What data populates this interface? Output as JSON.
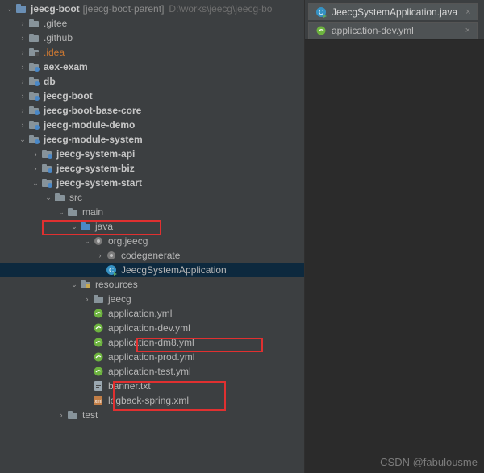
{
  "project": {
    "root_name": "jeecg-boot",
    "root_suffix": "[jeecg-boot-parent]",
    "root_path": "D:\\works\\jeecg\\jeecg-bo"
  },
  "tree": [
    {
      "d": 0,
      "arrow": "down",
      "icon": "proj",
      "label": "jeecg-boot",
      "extra": "root"
    },
    {
      "d": 1,
      "arrow": "right",
      "icon": "folder",
      "label": ".gitee"
    },
    {
      "d": 1,
      "arrow": "right",
      "icon": "folder",
      "label": ".github"
    },
    {
      "d": 1,
      "arrow": "right",
      "icon": "folderx",
      "label": ".idea",
      "style": "idea"
    },
    {
      "d": 1,
      "arrow": "right",
      "icon": "module",
      "label": "aex-exam",
      "bold": true
    },
    {
      "d": 1,
      "arrow": "right",
      "icon": "module",
      "label": "db",
      "bold": true
    },
    {
      "d": 1,
      "arrow": "right",
      "icon": "module",
      "label": "jeecg-boot",
      "bold": true
    },
    {
      "d": 1,
      "arrow": "right",
      "icon": "module",
      "label": "jeecg-boot-base-core",
      "bold": true
    },
    {
      "d": 1,
      "arrow": "right",
      "icon": "module",
      "label": "jeecg-module-demo",
      "bold": true
    },
    {
      "d": 1,
      "arrow": "down",
      "icon": "module",
      "label": "jeecg-module-system",
      "bold": true
    },
    {
      "d": 2,
      "arrow": "right",
      "icon": "module",
      "label": "jeecg-system-api",
      "bold": true
    },
    {
      "d": 2,
      "arrow": "right",
      "icon": "module",
      "label": "jeecg-system-biz",
      "bold": true
    },
    {
      "d": 2,
      "arrow": "down",
      "icon": "module",
      "label": "jeecg-system-start",
      "bold": true
    },
    {
      "d": 3,
      "arrow": "down",
      "icon": "folder",
      "label": "src"
    },
    {
      "d": 4,
      "arrow": "down",
      "icon": "folder",
      "label": "main"
    },
    {
      "d": 5,
      "arrow": "down",
      "icon": "srcroot",
      "label": "java"
    },
    {
      "d": 6,
      "arrow": "down",
      "icon": "package",
      "label": "org.jeecg"
    },
    {
      "d": 7,
      "arrow": "right",
      "icon": "package",
      "label": "codegenerate"
    },
    {
      "d": 7,
      "arrow": "none",
      "icon": "class-run",
      "label": "JeecgSystemApplication",
      "selected": true
    },
    {
      "d": 5,
      "arrow": "down",
      "icon": "resroot",
      "label": "resources"
    },
    {
      "d": 6,
      "arrow": "right",
      "icon": "folder",
      "label": "jeecg"
    },
    {
      "d": 6,
      "arrow": "none",
      "icon": "spring",
      "label": "application.yml"
    },
    {
      "d": 6,
      "arrow": "none",
      "icon": "spring",
      "label": "application-dev.yml"
    },
    {
      "d": 6,
      "arrow": "none",
      "icon": "spring",
      "label": "application-dm8.yml"
    },
    {
      "d": 6,
      "arrow": "none",
      "icon": "spring",
      "label": "application-prod.yml"
    },
    {
      "d": 6,
      "arrow": "none",
      "icon": "spring",
      "label": "application-test.yml"
    },
    {
      "d": 6,
      "arrow": "none",
      "icon": "text",
      "label": "banner.txt"
    },
    {
      "d": 6,
      "arrow": "none",
      "icon": "xml",
      "label": "logback-spring.xml"
    },
    {
      "d": 4,
      "arrow": "right",
      "icon": "folder",
      "label": "test"
    }
  ],
  "tabs": [
    {
      "icon": "class-run",
      "label": "JeecgSystemApplication.java",
      "active": true,
      "close": "×"
    },
    {
      "icon": "spring",
      "label": "application-dev.yml",
      "active": false,
      "close": "×"
    }
  ],
  "watermark": "CSDN @fabulousme"
}
